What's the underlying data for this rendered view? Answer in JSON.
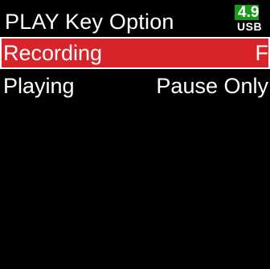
{
  "header": {
    "title": "PLAY Key Option",
    "battery": {
      "value": "4.9",
      "source": "USB",
      "level_fraction": 0.75,
      "color": "#1a9a1a"
    }
  },
  "menu": {
    "items": [
      {
        "label": "Recording",
        "value": "F",
        "selected": true
      },
      {
        "label": "Playing",
        "value": "Pause Only",
        "selected": false
      }
    ]
  },
  "colors": {
    "background": "#000000",
    "text": "#ffffff",
    "selection": "#d8232a"
  }
}
